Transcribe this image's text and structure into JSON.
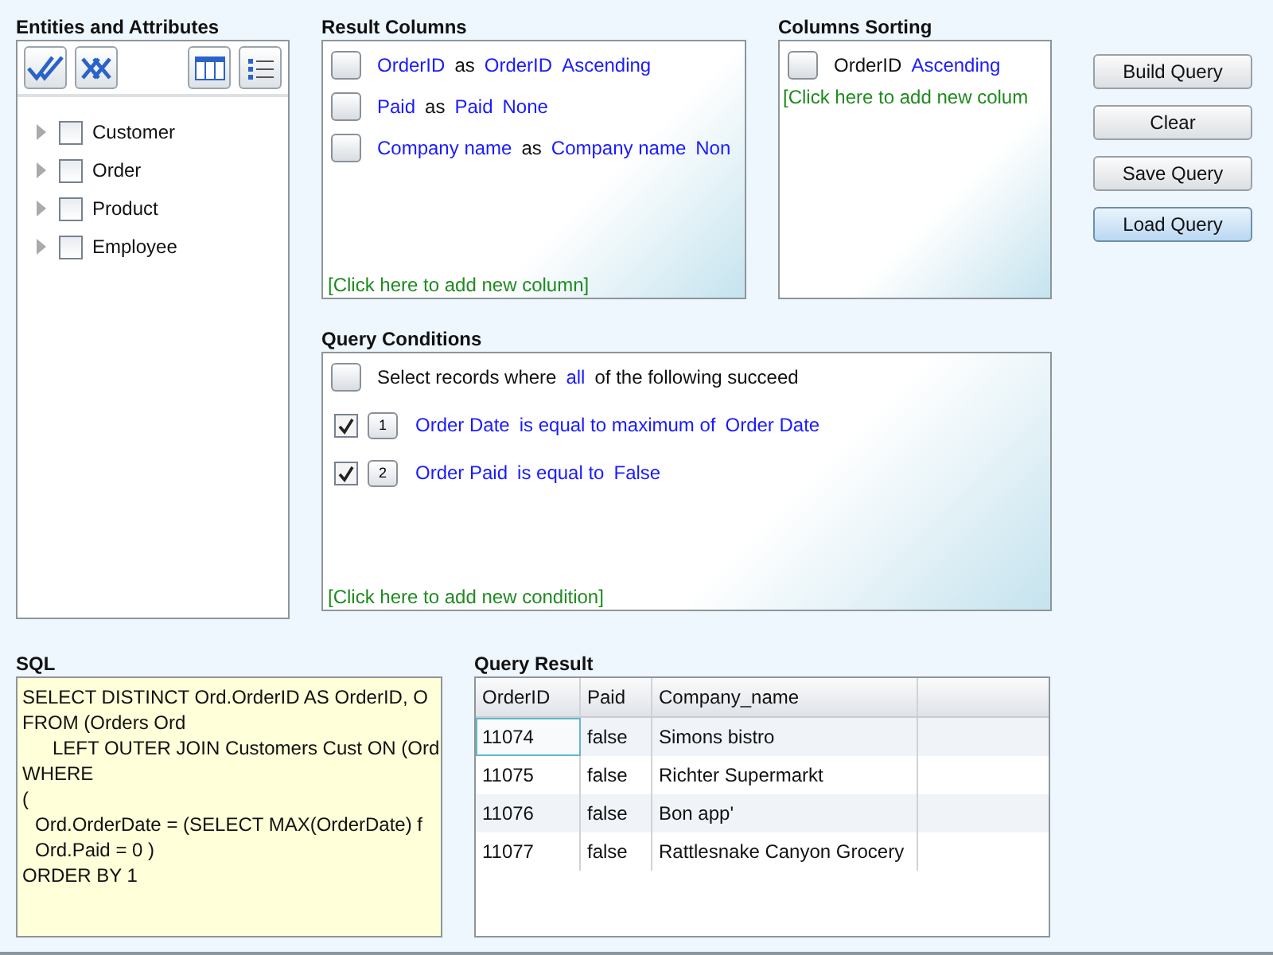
{
  "entities": {
    "title": "Entities and Attributes",
    "items": [
      {
        "label": "Customer",
        "checked": false,
        "expanded": false
      },
      {
        "label": "Order",
        "checked": false,
        "expanded": false
      },
      {
        "label": "Product",
        "checked": false,
        "expanded": false
      },
      {
        "label": "Employee",
        "checked": false,
        "expanded": false
      }
    ]
  },
  "result_columns": {
    "title": "Result Columns",
    "items": [
      {
        "checked": false,
        "field": "OrderID",
        "as": "as",
        "alias": "OrderID",
        "sort": "Ascending"
      },
      {
        "checked": false,
        "field": "Paid",
        "as": "as",
        "alias": "Paid",
        "sort": "None"
      },
      {
        "checked": false,
        "field": "Company name",
        "as": "as",
        "alias": "Company name",
        "sort": "Non"
      }
    ],
    "add_link": "[Click here to add new column]"
  },
  "columns_sorting": {
    "title": "Columns Sorting",
    "items": [
      {
        "checked": false,
        "field": "OrderID",
        "order": "Ascending"
      }
    ],
    "add_link": "[Click here to add new colum"
  },
  "buttons": [
    {
      "label": "Build Query",
      "hovered": false
    },
    {
      "label": "Clear",
      "hovered": false
    },
    {
      "label": "Save Query",
      "hovered": false
    },
    {
      "label": "Load Query",
      "hovered": true
    }
  ],
  "query_conditions": {
    "title": "Query Conditions",
    "header": {
      "checked": false,
      "before": "Select records where",
      "mode": "all",
      "after": "of the following succeed"
    },
    "items": [
      {
        "checked": true,
        "number": "1",
        "field": "Order Date",
        "operator": "is equal to maximum of",
        "value": "Order Date"
      },
      {
        "checked": true,
        "number": "2",
        "field": "Order Paid",
        "operator": "is equal to",
        "value": "False"
      }
    ],
    "add_link": "[Click here to add new condition]"
  },
  "sql": {
    "title": "SQL",
    "lines": [
      {
        "text": "SELECT DISTINCT Ord.OrderID AS OrderID, O",
        "kind": "plain"
      },
      {
        "text": "FROM (Orders Ord",
        "kind": "plain"
      },
      {
        "text": "LEFT OUTER JOIN Customers Cust ON (Ord",
        "kind": "indent2"
      },
      {
        "text": "WHERE",
        "kind": "plain"
      },
      {
        "text": "(",
        "kind": "plain"
      },
      {
        "text": "Ord.OrderDate = (SELECT MAX(OrderDate) f",
        "kind": "indent1"
      },
      {
        "text": "Ord.Paid = 0 )",
        "kind": "indent1"
      },
      {
        "text": "ORDER BY  1",
        "kind": "plain"
      }
    ]
  },
  "query_result": {
    "title": "Query Result",
    "columns": [
      "OrderID",
      "Paid",
      "Company_name"
    ],
    "rows": [
      {
        "cells": [
          "11074",
          "false",
          "Simons bistro"
        ],
        "selected": true
      },
      {
        "cells": [
          "11075",
          "false",
          "Richter Supermarkt"
        ],
        "selected": false
      },
      {
        "cells": [
          "11076",
          "false",
          "Bon app'"
        ],
        "selected": false
      },
      {
        "cells": [
          "11077",
          "false",
          "Rattlesnake Canyon Grocery"
        ],
        "selected": false
      }
    ]
  }
}
